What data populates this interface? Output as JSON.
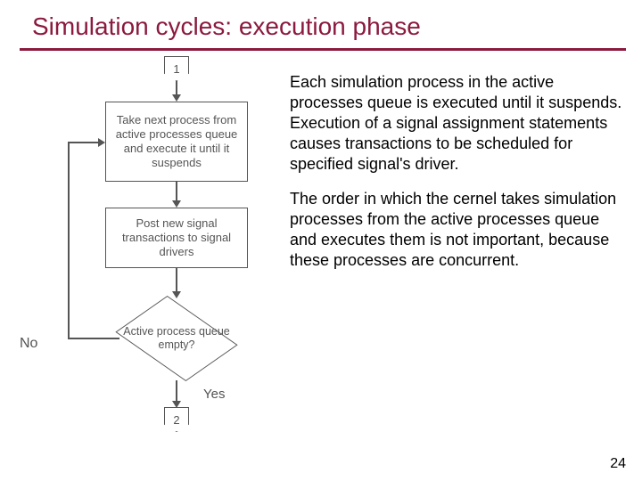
{
  "title": "Simulation cycles: execution phase",
  "flowchart": {
    "connector_top": "1",
    "box1": "Take next process from active processes queue and execute it until it suspends",
    "box2": "Post new signal transactions to signal drivers",
    "decision": "Active process queue empty?",
    "no_label": "No",
    "yes_label": "Yes",
    "connector_bottom": "2"
  },
  "paragraphs": {
    "p1": "Each simulation process in the active processes queue is executed until it suspends. Execution of a signal assignment statements causes transactions to be scheduled for specified signal's driver.",
    "p2": "The order in which the cernel takes simulation processes from the active processes queue and executes them is not important, because these processes are concurrent."
  },
  "page_number": "24"
}
